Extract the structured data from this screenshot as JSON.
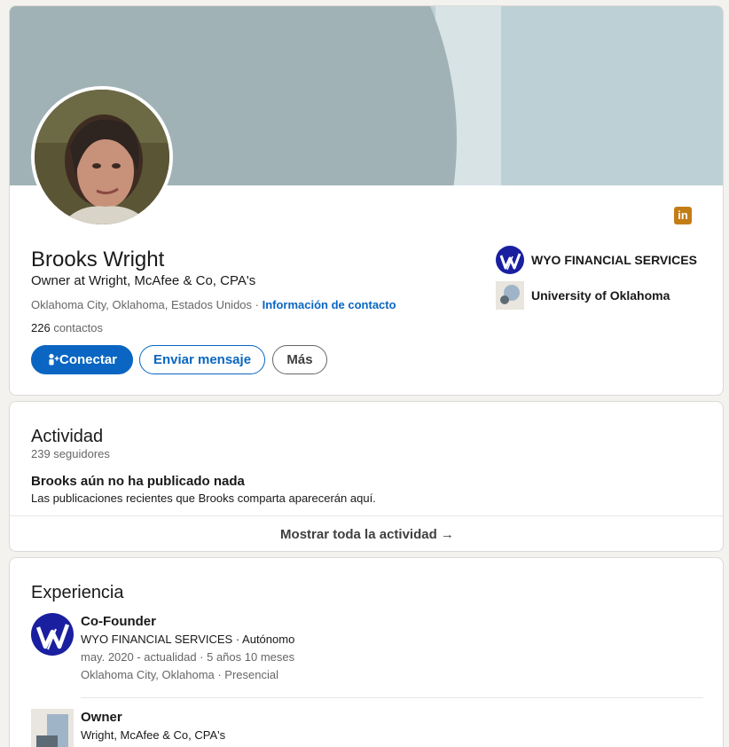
{
  "profile": {
    "name": "Brooks Wright",
    "headline": "Owner at Wright, McAfee & Co, CPA's",
    "location": "Oklahoma City, Oklahoma, Estados Unidos",
    "separator": " · ",
    "contact_info": "Información de contacto",
    "connections_count": "226",
    "connections_label": "contactos",
    "linkedin_badge": "in",
    "buttons": {
      "connect": "Conectar",
      "message": "Enviar mensaje",
      "more": "Más"
    },
    "organizations": [
      {
        "name": "WYO FINANCIAL SERVICES",
        "logo": "wyo-logo-icon"
      },
      {
        "name": "University of Oklahoma",
        "logo": "university-logo-icon"
      }
    ]
  },
  "activity": {
    "title": "Actividad",
    "followers": "239 seguidores",
    "empty_title": "Brooks aún no ha publicado nada",
    "empty_subtitle": "Las publicaciones recientes que Brooks comparta aparecerán aquí.",
    "show_all": "Mostrar toda la actividad →"
  },
  "experience": {
    "title": "Experiencia",
    "items": [
      {
        "role": "Co-Founder",
        "company": "WYO FINANCIAL SERVICES · Autónomo",
        "dates": "may. 2020 - actualidad · 5 años 10 meses",
        "place": "Oklahoma City, Oklahoma · Presencial"
      },
      {
        "role": "Owner",
        "company": "Wright, McAfee & Co, CPA's"
      }
    ]
  },
  "colors": {
    "brand_blue": "#0a66c2",
    "banner_dark": "#a0b2b6",
    "banner_light": "#bdd0d5",
    "linkedin_badge": "#c37d16"
  }
}
